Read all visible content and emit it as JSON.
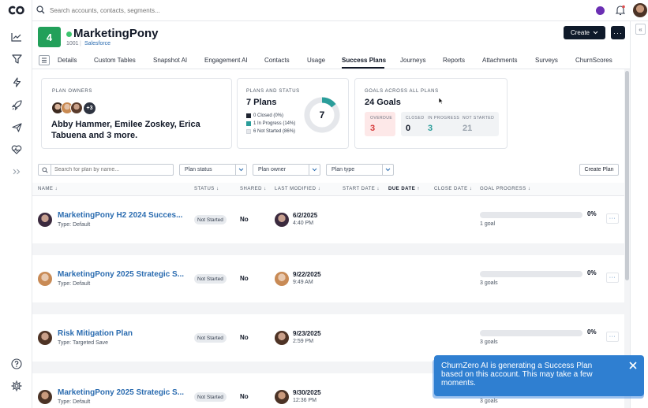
{
  "topbar": {
    "search_placeholder": "Search accounts, contacts, segments..."
  },
  "account": {
    "badge_number": "4",
    "name": "MarketingPony",
    "id": "1001",
    "source": "Salesforce",
    "create_label": "Create",
    "more_label": "···"
  },
  "tabs": [
    {
      "label": "Details"
    },
    {
      "label": "Custom Tables"
    },
    {
      "label": "Snapshot AI"
    },
    {
      "label": "Engagement AI"
    },
    {
      "label": "Contacts"
    },
    {
      "label": "Usage"
    },
    {
      "label": "Success Plans"
    },
    {
      "label": "Journeys"
    },
    {
      "label": "Reports"
    },
    {
      "label": "Attachments"
    },
    {
      "label": "Surveys"
    },
    {
      "label": "ChurnScores"
    }
  ],
  "plan_owners": {
    "title": "PLAN OWNERS",
    "more_count": "+3",
    "names": "Abby Hammer, Emilee Zoskey, Erica Tabuena and 3 more."
  },
  "plans_status": {
    "title": "PLANS AND STATUS",
    "count_label": "7 Plans",
    "total": "7",
    "legend": [
      {
        "label": "0 Closed (0%)",
        "value": 0,
        "color": "#1f2430"
      },
      {
        "label": "1 In Progress (14%)",
        "value": 1,
        "color": "#2a9d9a"
      },
      {
        "label": "6 Not Started (86%)",
        "value": 6,
        "color": "#e5e7eb"
      }
    ]
  },
  "goals": {
    "title": "GOALS ACROSS ALL PLANS",
    "count_label": "24 Goals",
    "overdue_label": "OVERDUE",
    "overdue_value": "3",
    "closed_label": "CLOSED",
    "closed_value": "0",
    "in_progress_label": "IN PROGRESS",
    "in_progress_value": "3",
    "not_started_label": "NOT STARTED",
    "not_started_value": "21"
  },
  "filters": {
    "search_placeholder": "Search for plan by name...",
    "plan_status": "Plan status",
    "plan_owner": "Plan owner",
    "plan_type": "Plan type",
    "create_plan": "Create Plan"
  },
  "table": {
    "headers": {
      "name": "NAME",
      "status": "STATUS",
      "shared": "SHARED",
      "last_modified": "LAST MODIFIED",
      "start_date": "START DATE",
      "due_date": "DUE DATE",
      "close_date": "CLOSE DATE",
      "goal_progress": "GOAL PROGRESS"
    },
    "rows": [
      {
        "name": "MarketingPony H2 2024 Succes...",
        "type": "Type: Default",
        "status": "Not Started",
        "shared": "No",
        "date": "6/2/2025",
        "time": "4:40 PM",
        "progress": "0%",
        "progress_value": 0,
        "goals": "1 goal"
      },
      {
        "name": "MarketingPony 2025 Strategic S...",
        "type": "Type: Default",
        "status": "Not Started",
        "shared": "No",
        "date": "9/22/2025",
        "time": "9:49 AM",
        "progress": "0%",
        "progress_value": 0,
        "goals": "3 goals"
      },
      {
        "name": "Risk Mitigation Plan",
        "type": "Type: Targeted Save",
        "status": "Not Started",
        "shared": "No",
        "date": "9/23/2025",
        "time": "2:59 PM",
        "progress": "0%",
        "progress_value": 0,
        "goals": "3 goals"
      },
      {
        "name": "MarketingPony 2025 Strategic S...",
        "type": "Type: Default",
        "status": "Not Started",
        "shared": "No",
        "date": "9/30/2025",
        "time": "12:36 PM",
        "progress": "",
        "progress_value": 0,
        "goals": "3 goals"
      }
    ]
  },
  "toast": {
    "message": "ChurnZero AI is generating a Success Plan based on this account. This may take a few moments."
  }
}
